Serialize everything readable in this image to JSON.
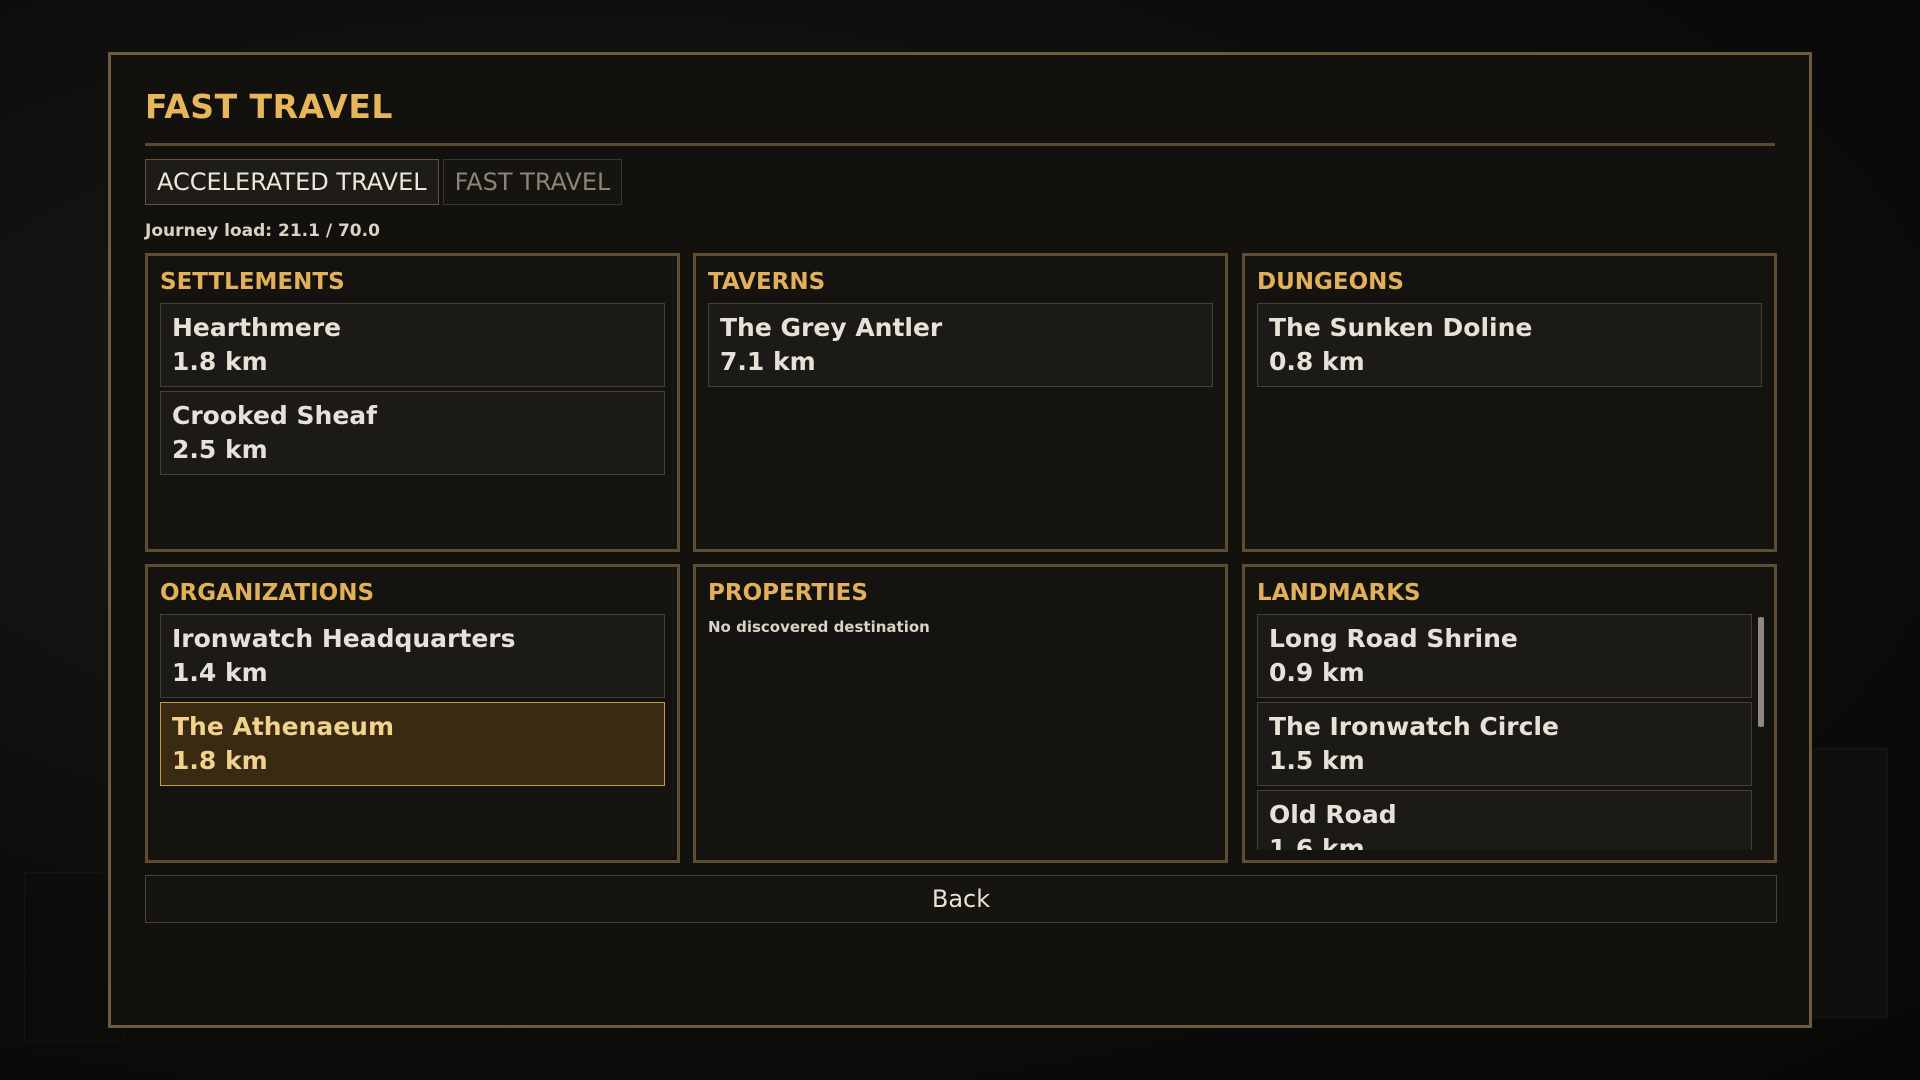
{
  "window": {
    "title": "FAST TRAVEL"
  },
  "tabs": [
    {
      "label": "ACCELERATED TRAVEL",
      "active": true
    },
    {
      "label": "FAST TRAVEL",
      "active": false
    }
  ],
  "journey": {
    "text": "Journey load: 21.1 / 70.0"
  },
  "sections": {
    "settlements": {
      "title": "SETTLEMENTS",
      "items": [
        {
          "name": "Hearthmere",
          "distance": "1.8 km"
        },
        {
          "name": "Crooked Sheaf",
          "distance": "2.5 km"
        }
      ]
    },
    "taverns": {
      "title": "TAVERNS",
      "items": [
        {
          "name": "The Grey Antler",
          "distance": "7.1 km"
        }
      ]
    },
    "dungeons": {
      "title": "DUNGEONS",
      "items": [
        {
          "name": "The Sunken Doline",
          "distance": "0.8 km"
        }
      ]
    },
    "organizations": {
      "title": "ORGANIZATIONS",
      "items": [
        {
          "name": "Ironwatch Headquarters",
          "distance": "1.4 km"
        },
        {
          "name": "The Athenaeum",
          "distance": "1.8 km",
          "selected": true
        }
      ]
    },
    "properties": {
      "title": "PROPERTIES",
      "empty_text": "No discovered destination"
    },
    "landmarks": {
      "title": "LANDMARKS",
      "items": [
        {
          "name": "Long Road Shrine",
          "distance": "0.9 km"
        },
        {
          "name": "The Ironwatch Circle",
          "distance": "1.5 km"
        },
        {
          "name": "Old Road",
          "distance": "1.6 km"
        }
      ]
    }
  },
  "actions": {
    "back_label": "Back"
  },
  "colors": {
    "accent": "#e2b05a",
    "border": "#5e4c33",
    "selected_bg": "#3b2a12"
  }
}
